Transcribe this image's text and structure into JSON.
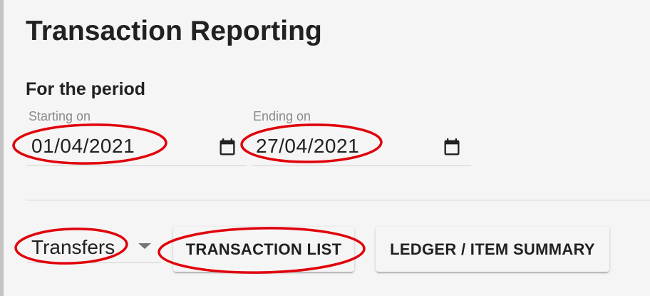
{
  "page": {
    "title": "Transaction Reporting"
  },
  "period": {
    "heading": "For the period",
    "start": {
      "label": "Starting on",
      "value": "01/04/2021"
    },
    "end": {
      "label": "Ending on",
      "value": "27/04/2021"
    }
  },
  "report": {
    "type_selected": "Transfers",
    "buttons": {
      "transaction_list": "TRANSACTION LIST",
      "ledger_summary": "LEDGER / ITEM SUMMARY"
    }
  },
  "colors": {
    "annotation": "#e0000b",
    "background": "#f5f5f5",
    "text": "#212121"
  }
}
